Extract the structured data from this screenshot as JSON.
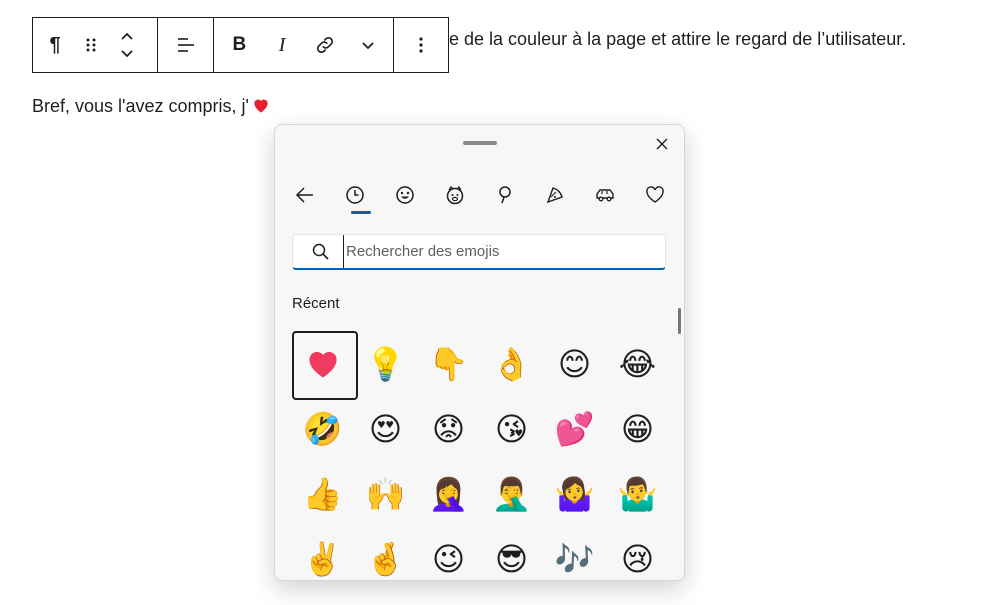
{
  "editor": {
    "paragraph1_tail": "e de la couleur à la page et attire le regard de l’utilisateur.",
    "paragraph2": "Bref, vous l'avez compris, j'",
    "paragraph2_heart": "❤️"
  },
  "toolbar": {
    "paragraph_icon": "¶",
    "drag_icon": "drag-handle-icon",
    "move_icon": "chevron-up-down-icon",
    "align_icon": "align-left-icon",
    "bold_label": "B",
    "italic_label": "I",
    "link_icon": "link-icon",
    "more_icon": "chevron-down-icon",
    "options_icon": "⋮"
  },
  "emoji_panel": {
    "close_icon": "close-icon",
    "categories": [
      "back-arrow-icon",
      "recent-clock-icon",
      "smiley-icon",
      "animal-icon",
      "food-icon",
      "pizza-icon",
      "car-icon",
      "heart-icon"
    ],
    "search": {
      "placeholder": "Rechercher des emojis",
      "value": ""
    },
    "section_title": "Récent",
    "accent_color": "#005fb8",
    "emojis": [
      [
        "❤️",
        "💡",
        "👇",
        "👌",
        "😊",
        "😂"
      ],
      [
        "🤣",
        "😍",
        "😟",
        "😘",
        "💕",
        "😁"
      ],
      [
        "👍",
        "🙌",
        "🤦‍♀️",
        "🤦‍♂️",
        "🤷‍♀️",
        "🤷‍♂️"
      ],
      [
        "✌️",
        "🤞",
        "😉",
        "😎",
        "🎶",
        "😢"
      ]
    ]
  }
}
